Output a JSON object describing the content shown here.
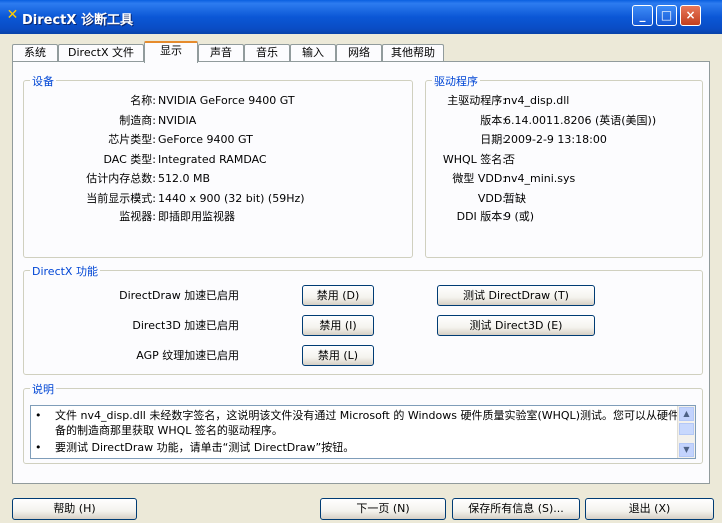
{
  "window": {
    "title": "DirectX 诊断工具",
    "minimize": "_",
    "maximize": "□",
    "close": "×"
  },
  "tabs": [
    "系统",
    "DirectX 文件",
    "显示",
    "声音",
    "音乐",
    "输入",
    "网络",
    "其他帮助"
  ],
  "active_tab": "显示",
  "device": {
    "legend": "设备",
    "rows": [
      {
        "label": "名称:",
        "value": "NVIDIA GeForce 9400 GT"
      },
      {
        "label": "制造商:",
        "value": "NVIDIA"
      },
      {
        "label": "芯片类型:",
        "value": "GeForce 9400 GT"
      },
      {
        "label": "DAC 类型:",
        "value": "Integrated RAMDAC"
      },
      {
        "label": "估计内存总数:",
        "value": "512.0 MB"
      },
      {
        "label": "当前显示模式:",
        "value": "1440 x 900 (32 bit) (59Hz)"
      },
      {
        "label": "监视器:",
        "value": "即插即用监视器"
      }
    ]
  },
  "driver": {
    "legend": "驱动程序",
    "rows": [
      {
        "label": "主驱动程序:",
        "value": "nv4_disp.dll"
      },
      {
        "label": "版本:",
        "value": "6.14.0011.8206 (英语(美国))"
      },
      {
        "label": "日期:",
        "value": "2009-2-9 13:18:00"
      },
      {
        "label": "WHQL 签名:",
        "value": "否"
      },
      {
        "label": "微型 VDD:",
        "value": "nv4_mini.sys"
      },
      {
        "label": "VDD:",
        "value": "暂缺"
      },
      {
        "label": "DDI 版本:",
        "value": "9 (或)"
      }
    ]
  },
  "features": {
    "legend": "DirectX 功能",
    "rows": [
      {
        "label": "DirectDraw 加速:",
        "status": "已启用",
        "disable": "禁用 (D)",
        "test": "测试 DirectDraw (T)"
      },
      {
        "label": "Direct3D 加速:",
        "status": "已启用",
        "disable": "禁用 (I)",
        "test": "测试 Direct3D (E)"
      },
      {
        "label": "AGP 纹理加速:",
        "status": "已启用",
        "disable": "禁用 (L)",
        "test": ""
      }
    ]
  },
  "notes": {
    "legend": "说明",
    "bullet": "•",
    "items": [
      "文件 nv4_disp.dll 未经数字签名，这说明该文件没有通过 Microsoft 的 Windows 硬件质量实验室(WHQL)测试。您可以从硬件设备的制造商那里获取 WHQL 签名的驱动程序。",
      "要测试 DirectDraw 功能，请单击“测试 DirectDraw”按钮。"
    ]
  },
  "buttons": {
    "help": "帮助 (H)",
    "next": "下一页 (N)",
    "save": "保存所有信息 (S)...",
    "exit": "退出 (X)"
  },
  "colors": {
    "title_bar": "#0b57d6",
    "group_legend": "#0046d5",
    "tab_highlight": "#e68b2c"
  }
}
